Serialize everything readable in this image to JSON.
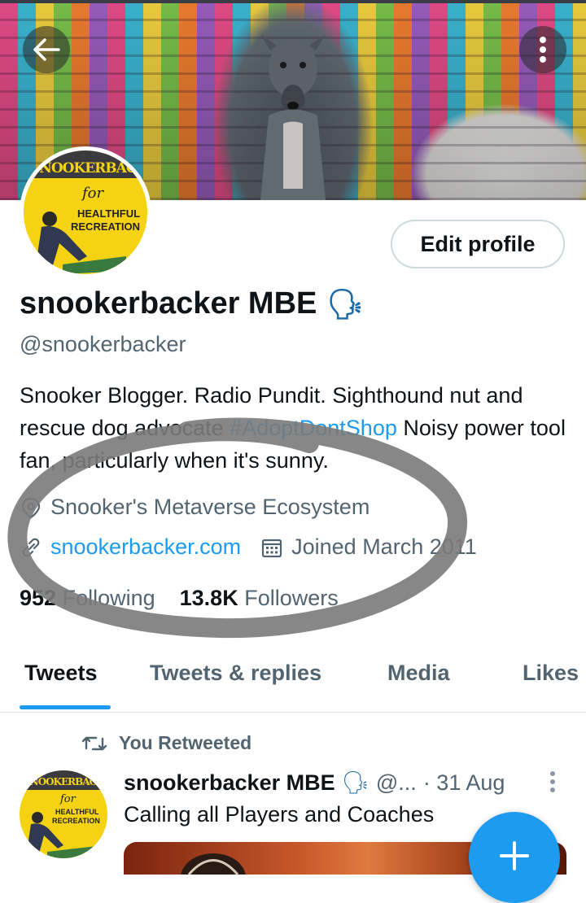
{
  "header": {
    "back_icon": "arrow-left-icon",
    "more_icon": "vertical-dots-icon"
  },
  "profile": {
    "display_name": "snookerbacker MBE",
    "name_emoji": "🗣",
    "handle": "@snookerbacker",
    "edit_label": "Edit profile",
    "avatar_text": {
      "top": "SNOOKERBACKER.COM",
      "for": "for",
      "line1": "HEALTHFUL",
      "line2": "RECREATION"
    },
    "bio": {
      "text1": "Snooker Blogger. Radio Pundit. Sighthound nut and rescue dog advocate ",
      "hashtag": "#AdoptDontShop",
      "text2": " Noisy power tool fan, particularly when it's sunny."
    },
    "location": "Snooker's Metaverse Ecosystem",
    "website": "snookerbacker.com",
    "joined": "Joined March 2011",
    "following_count": "952",
    "following_label": "Following",
    "followers_count": "13.8K",
    "followers_label": "Followers"
  },
  "tabs": [
    {
      "label": "Tweets",
      "active": true
    },
    {
      "label": "Tweets & replies",
      "active": false
    },
    {
      "label": "Media",
      "active": false
    },
    {
      "label": "Likes",
      "active": false
    }
  ],
  "tweet": {
    "retweet_label": "You Retweeted",
    "author": "snookerbacker MBE",
    "author_emoji": "🗣",
    "handle_short": "@...",
    "date": "· 31 Aug",
    "text": "Calling all Players and Coaches"
  },
  "colors": {
    "accent": "#1d9bf0",
    "muted": "#536471",
    "text": "#0f1419"
  }
}
